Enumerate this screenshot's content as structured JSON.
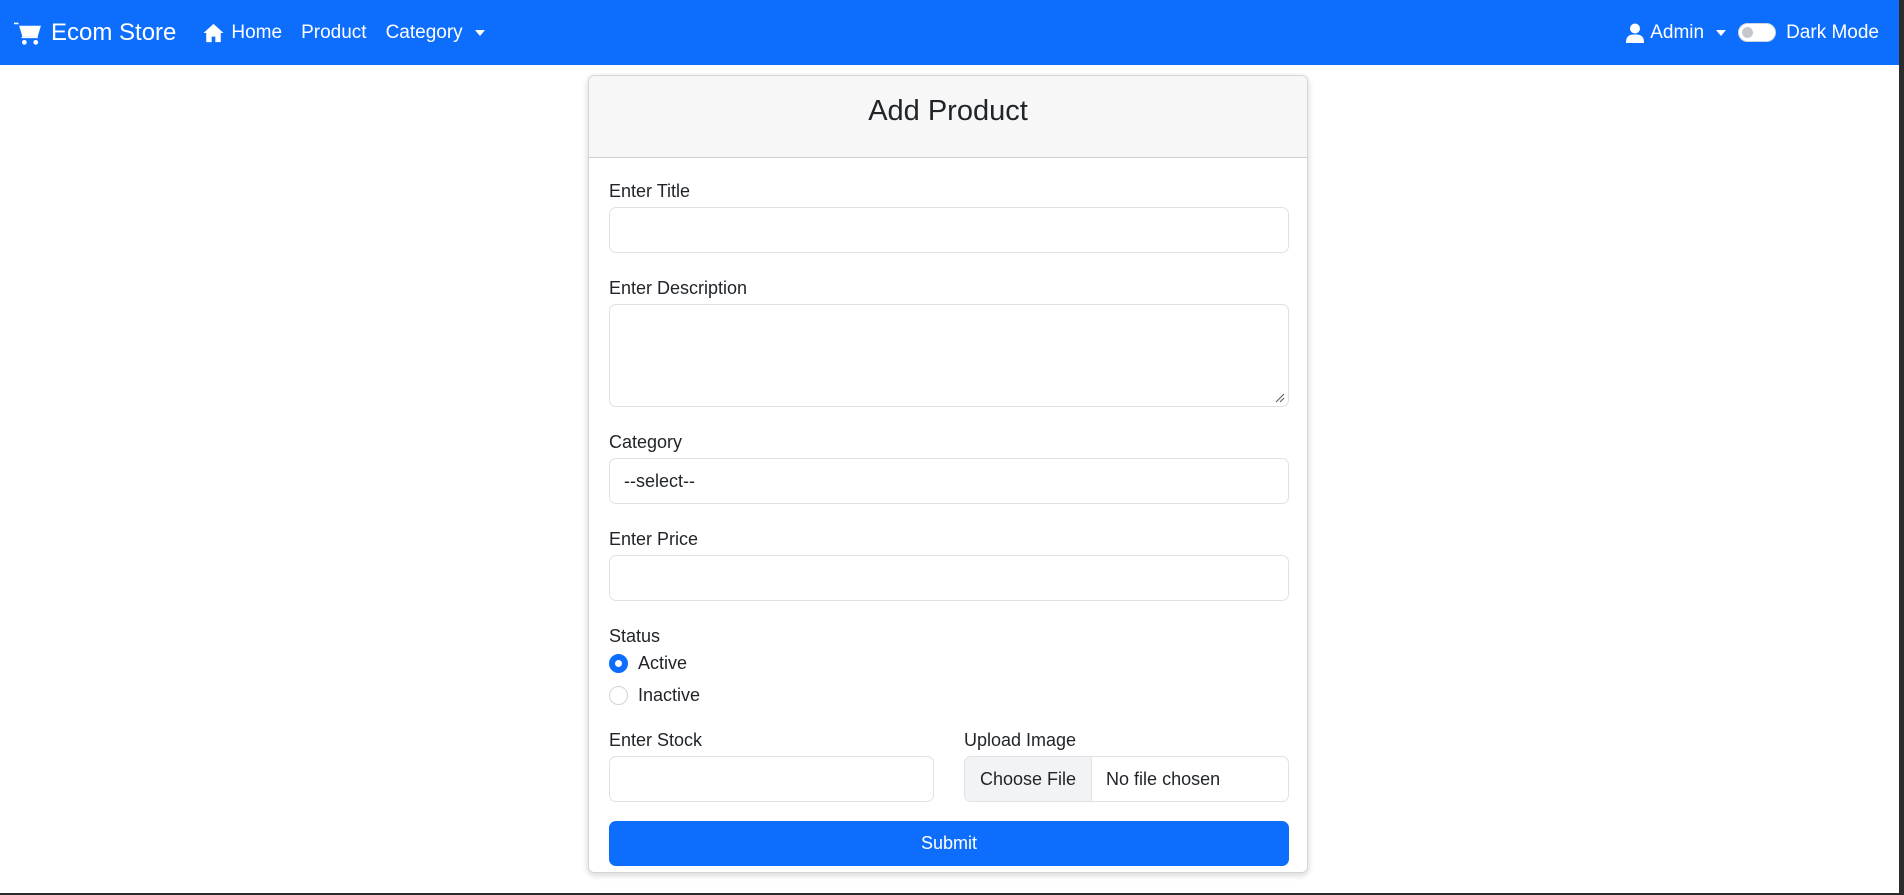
{
  "navbar": {
    "brand": "Ecom Store",
    "home": "Home",
    "product": "Product",
    "category": "Category",
    "admin": "Admin",
    "dark_mode": "Dark Mode"
  },
  "form": {
    "title": "Add Product",
    "title_label": "Enter Title",
    "title_value": "",
    "description_label": "Enter Description",
    "description_value": "",
    "category_label": "Category",
    "category_selected": "--select--",
    "price_label": "Enter Price",
    "price_value": "",
    "status_label": "Status",
    "status_options": [
      "Active",
      "Inactive"
    ],
    "status_selected": "Active",
    "stock_label": "Enter Stock",
    "stock_value": "",
    "image_label": "Upload Image",
    "choose_file": "Choose File",
    "no_file": "No file chosen",
    "submit": "Submit"
  },
  "colors": {
    "primary": "#0d6efd",
    "card_header_bg": "#f7f7f7"
  },
  "icons": {
    "brand": "shopping-cart-icon",
    "home": "home-icon",
    "admin": "user-icon"
  }
}
